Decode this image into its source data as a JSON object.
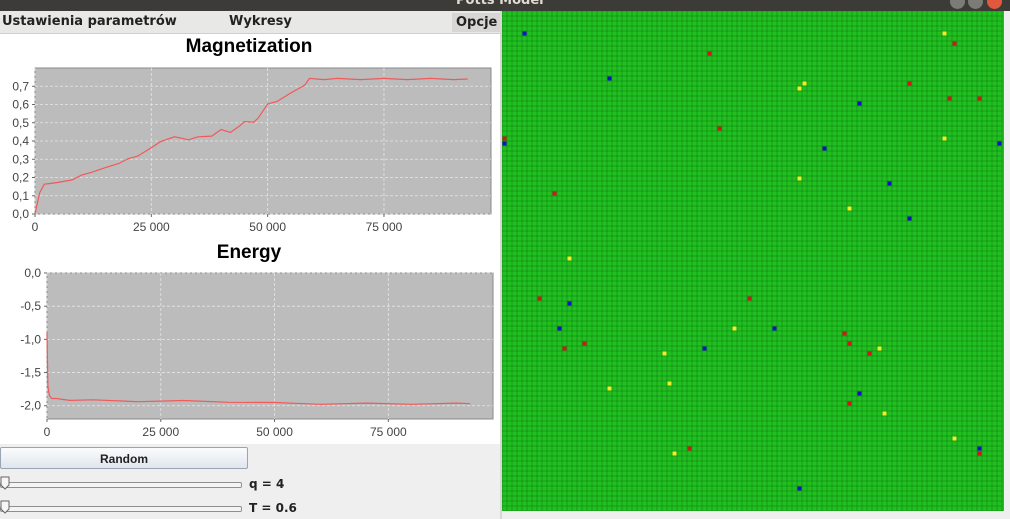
{
  "window": {
    "title": "Potts Model"
  },
  "menu": {
    "items": [
      "Ustawienia parametrów",
      "Wykresy",
      "Opcje"
    ]
  },
  "charts": {
    "magnetization": {
      "title": "Magnetization",
      "y_ticks": [
        "0,7",
        "0,6",
        "0,5",
        "0,4",
        "0,3",
        "0,2",
        "0,1",
        "0,0"
      ],
      "x_ticks": [
        "0",
        "25 000",
        "50 000",
        "75 000"
      ]
    },
    "energy": {
      "title": "Energy",
      "y_ticks": [
        "0,0",
        "-0,5",
        "-1,0",
        "-1,5",
        "-2,0"
      ],
      "x_ticks": [
        "0",
        "25 000",
        "50 000",
        "75 000"
      ]
    }
  },
  "chart_data": [
    {
      "type": "line",
      "title": "Magnetization",
      "xlim": [
        0,
        98000
      ],
      "ylim": [
        0,
        0.8
      ],
      "grid": true,
      "line_color": "#f05a5a",
      "series": [
        {
          "x": [
            0,
            1000,
            2000,
            3000,
            5000,
            8000,
            10000,
            12000,
            15000,
            18000,
            20000,
            22000,
            25000,
            27000,
            30000,
            33000,
            35000,
            38000,
            40000,
            42000,
            44000,
            45000,
            47000,
            48000,
            50000,
            52000,
            55000,
            58000,
            59000,
            62000,
            65000,
            70000,
            75000,
            80000,
            85000,
            90000,
            93000
          ],
          "y": [
            0.0,
            0.12,
            0.16,
            0.17,
            0.17,
            0.19,
            0.21,
            0.23,
            0.25,
            0.28,
            0.3,
            0.32,
            0.36,
            0.4,
            0.42,
            0.41,
            0.42,
            0.43,
            0.46,
            0.45,
            0.48,
            0.51,
            0.5,
            0.53,
            0.6,
            0.62,
            0.66,
            0.71,
            0.74,
            0.74,
            0.74,
            0.74,
            0.74,
            0.74,
            0.74,
            0.74,
            0.74
          ]
        }
      ]
    },
    {
      "type": "line",
      "title": "Energy",
      "xlim": [
        0,
        98000
      ],
      "ylim": [
        -2.2,
        0
      ],
      "grid": true,
      "line_color": "#f05a5a",
      "series": [
        {
          "x": [
            0,
            200,
            500,
            1000,
            2000,
            5000,
            10000,
            20000,
            30000,
            40000,
            50000,
            60000,
            70000,
            80000,
            90000,
            93000
          ],
          "y": [
            -0.9,
            -1.7,
            -1.85,
            -1.88,
            -1.9,
            -1.91,
            -1.92,
            -1.93,
            -1.93,
            -1.94,
            -1.96,
            -1.97,
            -1.97,
            -1.97,
            -1.97,
            -1.97
          ]
        }
      ]
    }
  ],
  "controls": {
    "random_label": "Random",
    "q": {
      "label": "q = 4",
      "fraction": 0.0
    },
    "T": {
      "label": "T = 0.6",
      "fraction": 0.0
    }
  },
  "lattice": {
    "cols": 100,
    "rows": 100,
    "background_state_color": "#20c020",
    "state_colors": {
      "red": "#d01818",
      "blue": "#1010c8",
      "yellow": "#f0f020",
      "green": "#20c020"
    },
    "minority_cells": [
      {
        "c": 4,
        "r": 4,
        "s": "blue"
      },
      {
        "c": 41,
        "r": 8,
        "s": "red"
      },
      {
        "c": 88,
        "r": 4,
        "s": "yellow"
      },
      {
        "c": 90,
        "r": 6,
        "s": "red"
      },
      {
        "c": 21,
        "r": 13,
        "s": "blue"
      },
      {
        "c": 60,
        "r": 14,
        "s": "yellow"
      },
      {
        "c": 59,
        "r": 15,
        "s": "yellow"
      },
      {
        "c": 81,
        "r": 14,
        "s": "red"
      },
      {
        "c": 89,
        "r": 17,
        "s": "red"
      },
      {
        "c": 95,
        "r": 17,
        "s": "red"
      },
      {
        "c": 71,
        "r": 18,
        "s": "blue"
      },
      {
        "c": 43,
        "r": 23,
        "s": "red"
      },
      {
        "c": 88,
        "r": 25,
        "s": "yellow"
      },
      {
        "c": 0,
        "r": 25,
        "s": "red"
      },
      {
        "c": 0,
        "r": 26,
        "s": "blue"
      },
      {
        "c": 64,
        "r": 27,
        "s": "blue"
      },
      {
        "c": 99,
        "r": 26,
        "s": "blue"
      },
      {
        "c": 59,
        "r": 33,
        "s": "yellow"
      },
      {
        "c": 77,
        "r": 34,
        "s": "blue"
      },
      {
        "c": 10,
        "r": 36,
        "s": "red"
      },
      {
        "c": 69,
        "r": 39,
        "s": "yellow"
      },
      {
        "c": 81,
        "r": 41,
        "s": "blue"
      },
      {
        "c": 13,
        "r": 49,
        "s": "yellow"
      },
      {
        "c": 7,
        "r": 57,
        "s": "red"
      },
      {
        "c": 13,
        "r": 58,
        "s": "blue"
      },
      {
        "c": 49,
        "r": 57,
        "s": "red"
      },
      {
        "c": 11,
        "r": 63,
        "s": "blue"
      },
      {
        "c": 46,
        "r": 63,
        "s": "yellow"
      },
      {
        "c": 54,
        "r": 63,
        "s": "blue"
      },
      {
        "c": 68,
        "r": 64,
        "s": "red"
      },
      {
        "c": 69,
        "r": 66,
        "s": "red"
      },
      {
        "c": 16,
        "r": 66,
        "s": "red"
      },
      {
        "c": 12,
        "r": 67,
        "s": "red"
      },
      {
        "c": 40,
        "r": 67,
        "s": "blue"
      },
      {
        "c": 32,
        "r": 68,
        "s": "yellow"
      },
      {
        "c": 75,
        "r": 67,
        "s": "yellow"
      },
      {
        "c": 73,
        "r": 68,
        "s": "red"
      },
      {
        "c": 33,
        "r": 74,
        "s": "yellow"
      },
      {
        "c": 21,
        "r": 75,
        "s": "yellow"
      },
      {
        "c": 71,
        "r": 76,
        "s": "blue"
      },
      {
        "c": 69,
        "r": 78,
        "s": "red"
      },
      {
        "c": 76,
        "r": 80,
        "s": "yellow"
      },
      {
        "c": 90,
        "r": 85,
        "s": "yellow"
      },
      {
        "c": 37,
        "r": 87,
        "s": "red"
      },
      {
        "c": 34,
        "r": 88,
        "s": "yellow"
      },
      {
        "c": 95,
        "r": 87,
        "s": "blue"
      },
      {
        "c": 95,
        "r": 88,
        "s": "red"
      },
      {
        "c": 59,
        "r": 95,
        "s": "blue"
      }
    ]
  }
}
